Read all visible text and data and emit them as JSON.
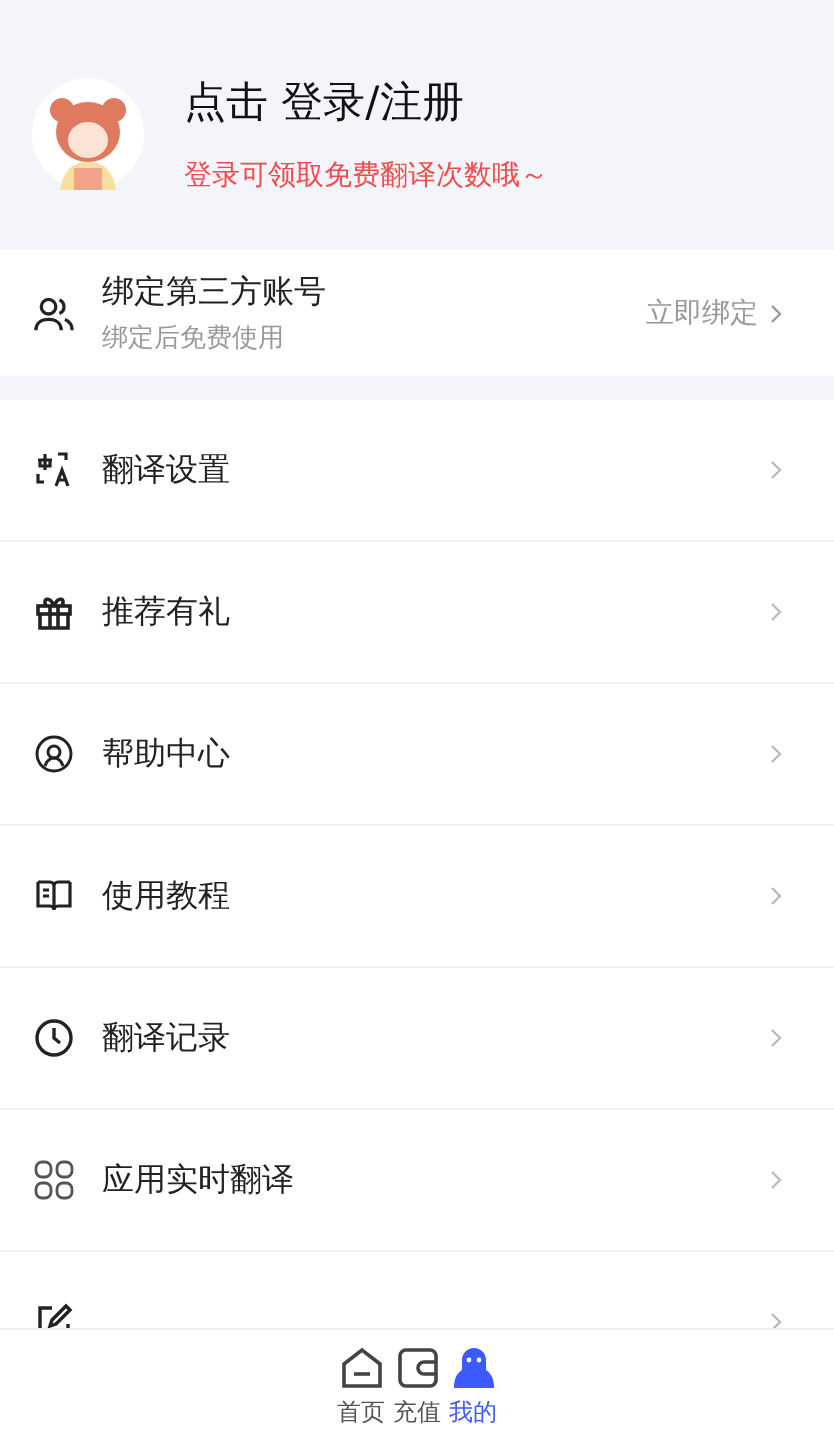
{
  "profile": {
    "title": "点击 登录/注册",
    "subtitle": "登录可领取免费翻译次数哦～"
  },
  "bind": {
    "title": "绑定第三方账号",
    "subtitle": "绑定后免费使用",
    "action": "立即绑定"
  },
  "menu": [
    {
      "label": "翻译设置"
    },
    {
      "label": "推荐有礼"
    },
    {
      "label": "帮助中心"
    },
    {
      "label": "使用教程"
    },
    {
      "label": "翻译记录"
    },
    {
      "label": "应用实时翻译"
    }
  ],
  "tabs": [
    {
      "label": "首页",
      "selected": false
    },
    {
      "label": "充值",
      "selected": false
    },
    {
      "label": "我的",
      "selected": true
    }
  ]
}
